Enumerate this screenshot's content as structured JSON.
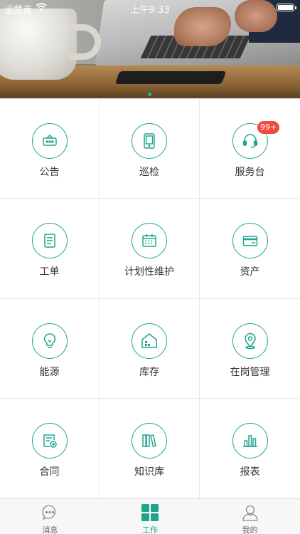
{
  "status_bar": {
    "carrier": "运营商",
    "time": "上午9:33"
  },
  "colors": {
    "accent": "#20a58d",
    "badge": "#f04a3e",
    "text": "#333333"
  },
  "grid": {
    "items": [
      {
        "label": "公告",
        "icon": "announcement-icon"
      },
      {
        "label": "巡检",
        "icon": "inspection-tablet-icon"
      },
      {
        "label": "服务台",
        "icon": "headset-icon",
        "badge": "99+"
      },
      {
        "label": "工单",
        "icon": "work-order-document-icon"
      },
      {
        "label": "计划性维护",
        "icon": "calendar-icon"
      },
      {
        "label": "资产",
        "icon": "card-icon"
      },
      {
        "label": "能源",
        "icon": "lightbulb-icon"
      },
      {
        "label": "库存",
        "icon": "warehouse-icon"
      },
      {
        "label": "在岗管理",
        "icon": "location-pin-icon"
      },
      {
        "label": "合同",
        "icon": "contract-icon"
      },
      {
        "label": "知识库",
        "icon": "books-icon"
      },
      {
        "label": "报表",
        "icon": "bar-chart-icon"
      }
    ]
  },
  "tabbar": {
    "tabs": [
      {
        "label": "消息",
        "icon": "chat-bubble-icon",
        "active": false
      },
      {
        "label": "工作",
        "icon": "grid-icon",
        "active": true
      },
      {
        "label": "我的",
        "icon": "user-icon",
        "active": false
      }
    ]
  }
}
